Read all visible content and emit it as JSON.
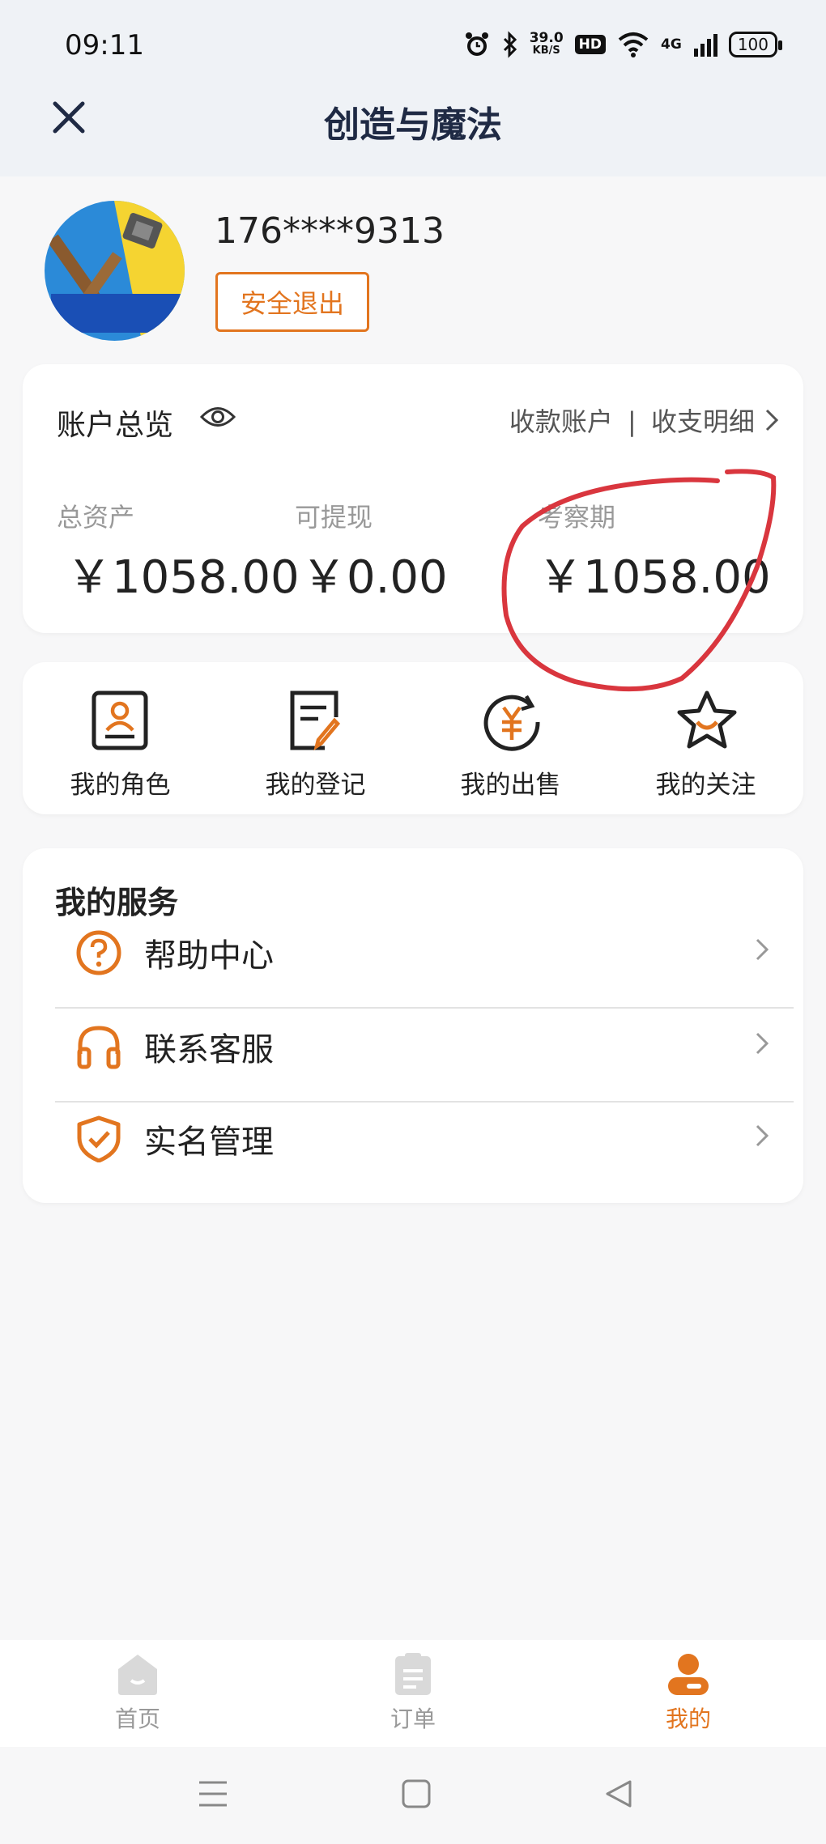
{
  "status_bar": {
    "time": "09:11",
    "speed_value": "39.0",
    "speed_unit": "KB/S",
    "hd": "HD",
    "network": "4G",
    "battery": "100"
  },
  "header": {
    "title": "创造与魔法"
  },
  "profile": {
    "phone": "176****9313",
    "logout_label": "安全退出"
  },
  "account": {
    "title": "账户总览",
    "link_receive": "收款账户",
    "link_separator": "|",
    "link_details": "收支明细",
    "stats": [
      {
        "label": "总资产",
        "value": "￥1058.00"
      },
      {
        "label": "可提现",
        "value": "￥0.00"
      },
      {
        "label": "考察期",
        "value": "￥1058.00"
      }
    ]
  },
  "shortcuts": [
    {
      "label": "我的角色",
      "icon": "role-card-icon"
    },
    {
      "label": "我的登记",
      "icon": "register-edit-icon"
    },
    {
      "label": "我的出售",
      "icon": "yuan-sale-icon"
    },
    {
      "label": "我的关注",
      "icon": "star-icon"
    }
  ],
  "services": {
    "title": "我的服务",
    "items": [
      {
        "label": "帮助中心",
        "icon": "question-icon"
      },
      {
        "label": "联系客服",
        "icon": "headset-icon"
      },
      {
        "label": "实名管理",
        "icon": "shield-check-icon"
      }
    ]
  },
  "bottom_nav": [
    {
      "label": "首页",
      "icon": "home-icon",
      "active": false
    },
    {
      "label": "订单",
      "icon": "order-icon",
      "active": false
    },
    {
      "label": "我的",
      "icon": "user-icon",
      "active": true
    }
  ],
  "colors": {
    "accent": "#e2751f",
    "annotation": "#d9363e",
    "header_bg": "#eff2f6"
  }
}
